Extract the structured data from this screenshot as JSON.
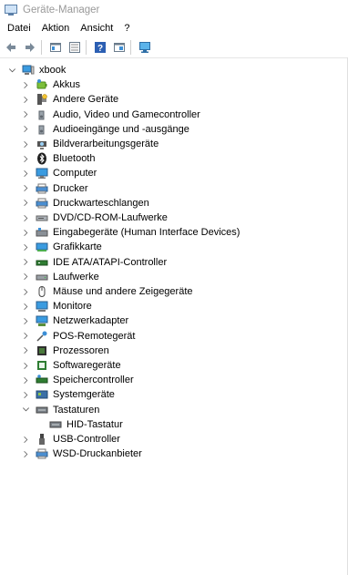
{
  "window": {
    "title": "Geräte-Manager"
  },
  "menu": [
    "Datei",
    "Aktion",
    "Ansicht",
    "?"
  ],
  "toolbar": [
    "back-icon",
    "forward-icon",
    "properties-icon",
    "show-hide-icon",
    "help-icon",
    "view-icon",
    "monitor-scan-icon"
  ],
  "tree": {
    "root": "xbook",
    "items": [
      {
        "label": "Akkus",
        "icon": "battery-icon"
      },
      {
        "label": "Andere Geräte",
        "icon": "unknown-device-icon"
      },
      {
        "label": "Audio, Video und Gamecontroller",
        "icon": "speaker-icon"
      },
      {
        "label": "Audioeingänge und -ausgänge",
        "icon": "speaker-icon"
      },
      {
        "label": "Bildverarbeitungsgeräte",
        "icon": "camera-icon"
      },
      {
        "label": "Bluetooth",
        "icon": "bluetooth-icon"
      },
      {
        "label": "Computer",
        "icon": "computer-icon"
      },
      {
        "label": "Drucker",
        "icon": "printer-icon"
      },
      {
        "label": "Druckwarteschlangen",
        "icon": "printer-icon"
      },
      {
        "label": "DVD/CD-ROM-Laufwerke",
        "icon": "disc-drive-icon"
      },
      {
        "label": "Eingabegeräte (Human Interface Devices)",
        "icon": "hid-icon"
      },
      {
        "label": "Grafikkarte",
        "icon": "display-adapter-icon"
      },
      {
        "label": "IDE ATA/ATAPI-Controller",
        "icon": "ide-controller-icon"
      },
      {
        "label": "Laufwerke",
        "icon": "disk-drive-icon"
      },
      {
        "label": "Mäuse und andere Zeigegeräte",
        "icon": "mouse-icon"
      },
      {
        "label": "Monitore",
        "icon": "monitor-icon"
      },
      {
        "label": "Netzwerkadapter",
        "icon": "network-adapter-icon"
      },
      {
        "label": "POS-Remotegerät",
        "icon": "pos-device-icon"
      },
      {
        "label": "Prozessoren",
        "icon": "processor-icon"
      },
      {
        "label": "Softwaregeräte",
        "icon": "software-device-icon"
      },
      {
        "label": "Speichercontroller",
        "icon": "storage-controller-icon"
      },
      {
        "label": "Systemgeräte",
        "icon": "system-device-icon"
      },
      {
        "label": "Tastaturen",
        "icon": "keyboard-icon",
        "expanded": true,
        "children": [
          {
            "label": "HID-Tastatur",
            "icon": "keyboard-icon"
          }
        ]
      },
      {
        "label": "USB-Controller",
        "icon": "usb-icon"
      },
      {
        "label": "WSD-Druckanbieter",
        "icon": "printer-icon"
      }
    ]
  }
}
